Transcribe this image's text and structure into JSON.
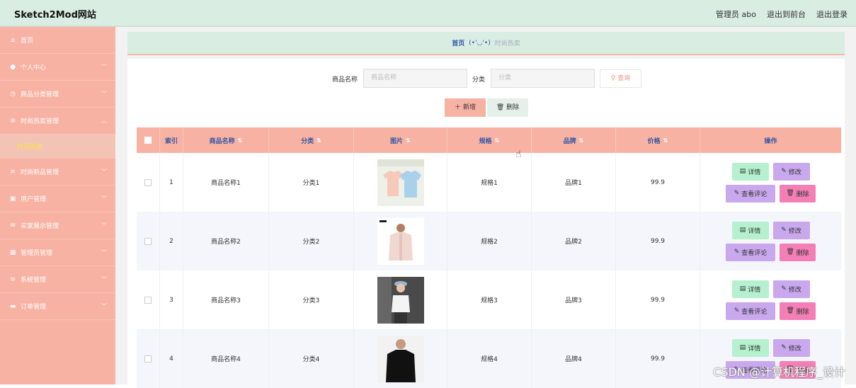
{
  "header": {
    "brand": "Sketch2Mod网站",
    "admin": "管理员 abo",
    "to_front": "退出到前台",
    "logout": "退出登录"
  },
  "sidebar": {
    "items": [
      {
        "label": "首页",
        "icon": "home-icon",
        "glyph": "⌂",
        "expandable": false
      },
      {
        "label": "个人中心",
        "icon": "user-icon",
        "glyph": "●",
        "expandable": true
      },
      {
        "label": "商品分类管理",
        "icon": "clock-icon",
        "glyph": "◷",
        "expandable": true
      },
      {
        "label": "时尚热卖管理",
        "icon": "circle-x-icon",
        "glyph": "⊗",
        "expandable": true,
        "expanded": true
      },
      {
        "label": "时尚新品管理",
        "icon": "menu-icon",
        "glyph": "≡",
        "expandable": true
      },
      {
        "label": "用户管理",
        "icon": "clipboard-icon",
        "glyph": "▣",
        "expandable": true
      },
      {
        "label": "买家展示管理",
        "icon": "mail-icon",
        "glyph": "✉",
        "expandable": true
      },
      {
        "label": "管理员管理",
        "icon": "grid-icon",
        "glyph": "▦",
        "expandable": true
      },
      {
        "label": "系统管理",
        "icon": "menu-icon",
        "glyph": "≡",
        "expandable": true
      },
      {
        "label": "订单管理",
        "icon": "ticket-icon",
        "glyph": "▬",
        "expandable": true
      }
    ],
    "active_sub": "时尚热卖"
  },
  "breadcrumb": {
    "home": "首页",
    "face": "(•'◡'•)",
    "current": "时尚热卖"
  },
  "search": {
    "name_label": "商品名称",
    "name_placeholder": "商品名称",
    "category_label": "分类",
    "category_placeholder": "分类",
    "query_label": "查询"
  },
  "actions": {
    "add_label": "新增",
    "delete_label": "删除"
  },
  "table": {
    "headers": [
      "索引",
      "商品名称",
      "分类",
      "图片",
      "规格",
      "品牌",
      "价格",
      "操作"
    ],
    "rows": [
      {
        "index": "1",
        "name": "商品名称1",
        "category": "分类1",
        "spec": "规格1",
        "brand": "品牌1",
        "price": "99.9"
      },
      {
        "index": "2",
        "name": "商品名称2",
        "category": "分类2",
        "spec": "规格2",
        "brand": "品牌2",
        "price": "99.9"
      },
      {
        "index": "3",
        "name": "商品名称3",
        "category": "分类3",
        "spec": "规格3",
        "brand": "品牌3",
        "price": "99.9"
      },
      {
        "index": "4",
        "name": "商品名称4",
        "category": "分类4",
        "spec": "规格4",
        "brand": "品牌4",
        "price": "99.9"
      }
    ],
    "ops": {
      "detail": "详情",
      "edit": "修改",
      "comment": "查看评论",
      "delete": "删除"
    }
  },
  "watermark": "CSDN @计算机程序_设计",
  "colors": {
    "header_bg": "#d9ede3",
    "sidebar_bg": "#f8b2a3",
    "active_sub_text": "#f5e64a",
    "link_blue": "#2f56a5",
    "op_detail": "#b5f0cf",
    "op_edit": "#c9a8ee",
    "op_delete": "#f47fb6"
  }
}
